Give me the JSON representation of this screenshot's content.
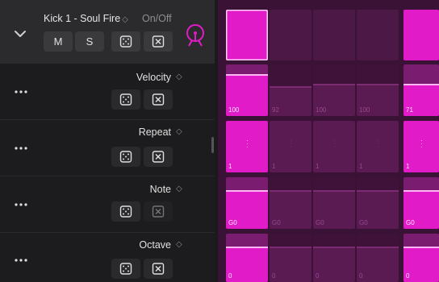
{
  "track": {
    "name": "Kick 1 - Soul Fire",
    "name_suffix": "◇",
    "onoff": "On/Off",
    "mute": "M",
    "solo": "S"
  },
  "params": [
    {
      "label": "Velocity",
      "values": [
        "100",
        "92",
        "100",
        "100",
        "71"
      ],
      "level": [
        0.78,
        0.55,
        0.6,
        0.6,
        0.6
      ]
    },
    {
      "label": "Repeat",
      "values": [
        "1",
        "1",
        "1",
        "1",
        "1"
      ],
      "level": [
        1,
        1,
        1,
        1,
        1
      ]
    },
    {
      "label": "Note",
      "values": [
        "G0",
        "G0",
        "G0",
        "G0",
        "G0"
      ],
      "level": [
        0.72,
        0.72,
        0.72,
        0.72,
        0.72
      ]
    },
    {
      "label": "Octave",
      "values": [
        "0",
        "0",
        "0",
        "0",
        "0"
      ],
      "level": [
        0.7,
        0.7,
        0.7,
        0.7,
        0.7
      ]
    }
  ],
  "steps_active": [
    true,
    false,
    false,
    false,
    true
  ],
  "colors": {
    "accent": "#e11bc8",
    "accent_dim": "#5a1a52",
    "grid_bg": "#3a1236",
    "cell_inactive": "#4c1846"
  }
}
